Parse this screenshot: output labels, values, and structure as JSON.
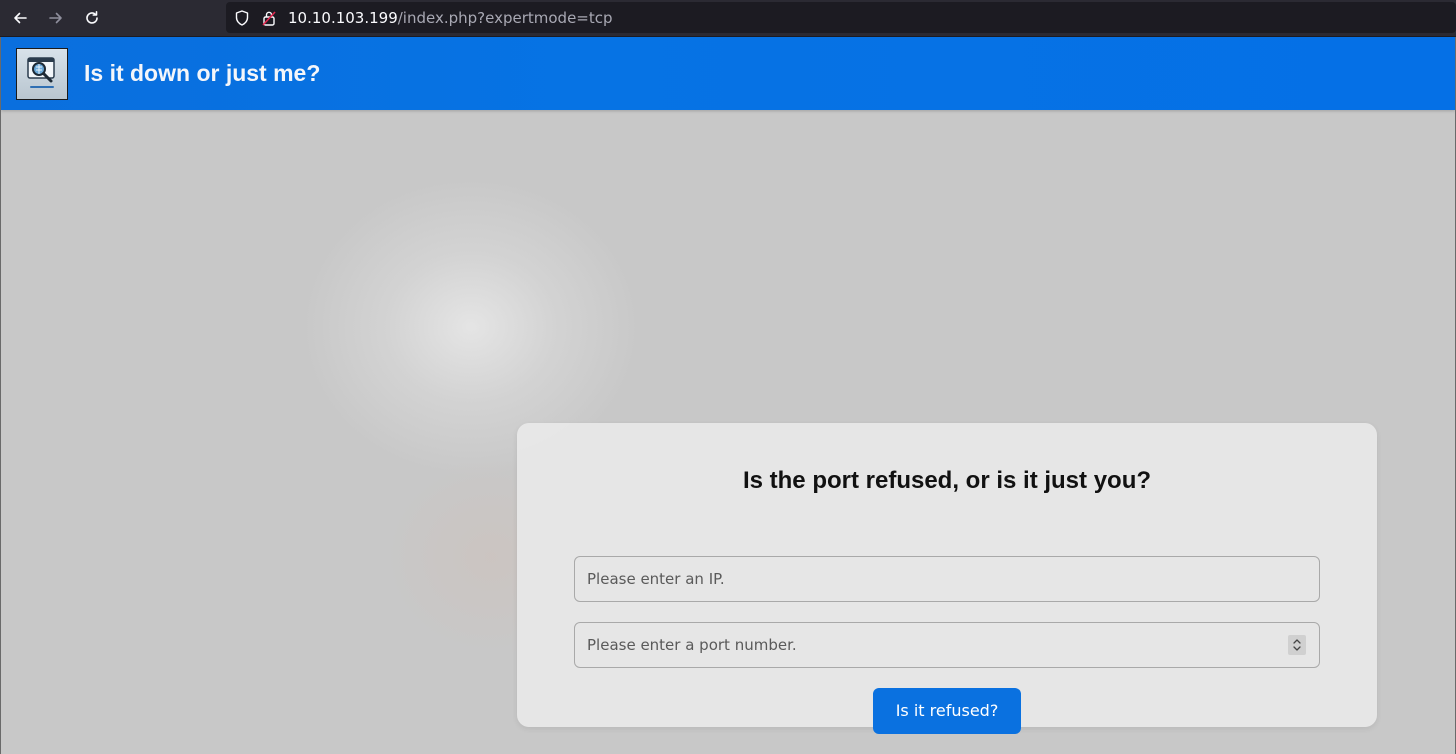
{
  "browser": {
    "url_host": "10.10.103.199",
    "url_path": "/index.php?expertmode=tcp",
    "icons": [
      "back-arrow-icon",
      "forward-arrow-icon",
      "reload-icon",
      "shield-icon",
      "lock-icon"
    ]
  },
  "header": {
    "title": "Is it down or just me?",
    "logo_icon": "magnifier-monitor-icon",
    "background_color": "#0673e4"
  },
  "form": {
    "heading": "Is the port refused, or is it just you?",
    "ip_placeholder": "Please enter an IP.",
    "port_placeholder": "Please enter a port number.",
    "submit_label": "Is it refused?",
    "button_color": "#0a71e0"
  }
}
